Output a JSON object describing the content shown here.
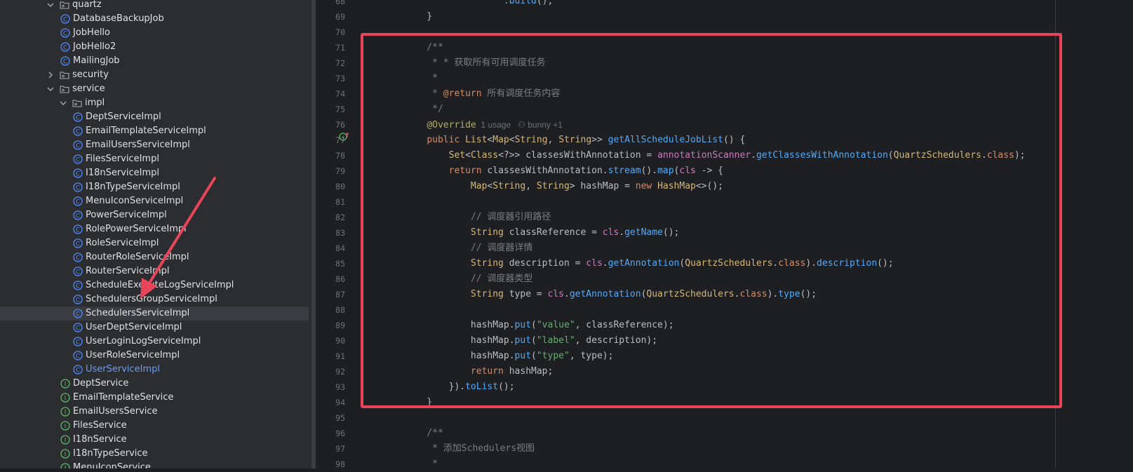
{
  "tree": {
    "items": [
      {
        "label": "quartz",
        "kind": "folder",
        "level": 0,
        "arrow": "down"
      },
      {
        "label": "DatabaseBackupJob",
        "kind": "class",
        "level": 1
      },
      {
        "label": "JobHello",
        "kind": "class",
        "level": 1
      },
      {
        "label": "JobHello2",
        "kind": "class",
        "level": 1
      },
      {
        "label": "MailingJob",
        "kind": "class",
        "level": 1
      },
      {
        "label": "security",
        "kind": "folder",
        "level": 0,
        "arrow": "right"
      },
      {
        "label": "service",
        "kind": "folder",
        "level": 0,
        "arrow": "down"
      },
      {
        "label": "impl",
        "kind": "folder",
        "level": 1,
        "arrow": "down"
      },
      {
        "label": "DeptServiceImpl",
        "kind": "class",
        "level": 2
      },
      {
        "label": "EmailTemplateServiceImpl",
        "kind": "class",
        "level": 2
      },
      {
        "label": "EmailUsersServiceImpl",
        "kind": "class",
        "level": 2
      },
      {
        "label": "FilesServiceImpl",
        "kind": "class",
        "level": 2
      },
      {
        "label": "I18nServiceImpl",
        "kind": "class",
        "level": 2
      },
      {
        "label": "I18nTypeServiceImpl",
        "kind": "class",
        "level": 2
      },
      {
        "label": "MenuIconServiceImpl",
        "kind": "class",
        "level": 2
      },
      {
        "label": "PowerServiceImpl",
        "kind": "class",
        "level": 2
      },
      {
        "label": "RolePowerServiceImpl",
        "kind": "class",
        "level": 2
      },
      {
        "label": "RoleServiceImpl",
        "kind": "class",
        "level": 2
      },
      {
        "label": "RouterRoleServiceImpl",
        "kind": "class",
        "level": 2
      },
      {
        "label": "RouterServiceImpl",
        "kind": "class",
        "level": 2
      },
      {
        "label": "ScheduleExecuteLogServiceImpl",
        "kind": "class",
        "level": 2
      },
      {
        "label": "SchedulersGroupServiceImpl",
        "kind": "class",
        "level": 2
      },
      {
        "label": "SchedulersServiceImpl",
        "kind": "class",
        "level": 2,
        "selected": true
      },
      {
        "label": "UserDeptServiceImpl",
        "kind": "class",
        "level": 2
      },
      {
        "label": "UserLoginLogServiceImpl",
        "kind": "class",
        "level": 2
      },
      {
        "label": "UserRoleServiceImpl",
        "kind": "class",
        "level": 2
      },
      {
        "label": "UserServiceImpl",
        "kind": "class",
        "level": 2,
        "blue": true
      },
      {
        "label": "DeptService",
        "kind": "interface",
        "level": 1
      },
      {
        "label": "EmailTemplateService",
        "kind": "interface",
        "level": 1
      },
      {
        "label": "EmailUsersService",
        "kind": "interface",
        "level": 1
      },
      {
        "label": "FilesService",
        "kind": "interface",
        "level": 1
      },
      {
        "label": "I18nService",
        "kind": "interface",
        "level": 1
      },
      {
        "label": "I18nTypeService",
        "kind": "interface",
        "level": 1
      },
      {
        "label": "MenuIconService",
        "kind": "interface",
        "level": 1
      }
    ]
  },
  "editor": {
    "first_line": 68,
    "lines": [
      [
        [
          "                  ",
          "dc"
        ],
        [
          ".build",
          "fn"
        ],
        [
          "();",
          "dc"
        ]
      ],
      [
        [
          "    }",
          "dc"
        ]
      ],
      [
        [
          "",
          "dc"
        ]
      ],
      [
        [
          "    /**",
          "cm"
        ]
      ],
      [
        [
          "     * * 获取所有可用调度任务",
          "cm"
        ]
      ],
      [
        [
          "     *",
          "cm"
        ]
      ],
      [
        [
          "     * ",
          "cm"
        ],
        [
          "@return",
          "dtag"
        ],
        [
          " 所有调度任务内容",
          "cm"
        ]
      ],
      [
        [
          "     */",
          "cm"
        ]
      ],
      [
        [
          "    ",
          "dc"
        ],
        [
          "@Override",
          "an"
        ],
        [
          "  1 usage   ⚇ bunny +1",
          "hint"
        ]
      ],
      [
        [
          "    ",
          "dc"
        ],
        [
          "public ",
          "kw"
        ],
        [
          "List",
          "ty"
        ],
        [
          "<",
          "dc"
        ],
        [
          "Map",
          "ty"
        ],
        [
          "<",
          "dc"
        ],
        [
          "String",
          "ty"
        ],
        [
          ", ",
          "dc"
        ],
        [
          "String",
          "ty"
        ],
        [
          ">> ",
          "dc"
        ],
        [
          "getAllScheduleJobList",
          "fn"
        ],
        [
          "() {",
          "dc"
        ]
      ],
      [
        [
          "        ",
          "dc"
        ],
        [
          "Set",
          "ty"
        ],
        [
          "<",
          "dc"
        ],
        [
          "Class",
          "ty"
        ],
        [
          "<?>> classesWithAnnotation = ",
          "dc"
        ],
        [
          "annotationScanner",
          "fld"
        ],
        [
          ".",
          "dc"
        ],
        [
          "getClassesWithAnnotation",
          "fn"
        ],
        [
          "(",
          "dc"
        ],
        [
          "QuartzSchedulers",
          "ty"
        ],
        [
          ".",
          "dc"
        ],
        [
          "class",
          "kw"
        ],
        [
          ");",
          "dc"
        ]
      ],
      [
        [
          "        ",
          "dc"
        ],
        [
          "return ",
          "kw"
        ],
        [
          "classesWithAnnotation.",
          "dc"
        ],
        [
          "stream",
          "fn"
        ],
        [
          "().",
          "dc"
        ],
        [
          "map",
          "fn"
        ],
        [
          "(",
          "dc"
        ],
        [
          "cls",
          "pm"
        ],
        [
          " -> {",
          "dc"
        ]
      ],
      [
        [
          "            ",
          "dc"
        ],
        [
          "Map",
          "ty"
        ],
        [
          "<",
          "dc"
        ],
        [
          "String",
          "ty"
        ],
        [
          ", ",
          "dc"
        ],
        [
          "String",
          "ty"
        ],
        [
          "> hashMap = ",
          "dc"
        ],
        [
          "new ",
          "kw"
        ],
        [
          "HashMap",
          "ty"
        ],
        [
          "<>();",
          "dc"
        ]
      ],
      [
        [
          "",
          "dc"
        ]
      ],
      [
        [
          "            // 调度器引用路径",
          "cm"
        ]
      ],
      [
        [
          "            ",
          "dc"
        ],
        [
          "String ",
          "ty"
        ],
        [
          "classReference = ",
          "dc"
        ],
        [
          "cls",
          "pm"
        ],
        [
          ".",
          "dc"
        ],
        [
          "getName",
          "fn"
        ],
        [
          "();",
          "dc"
        ]
      ],
      [
        [
          "            // 调度器详情",
          "cm"
        ]
      ],
      [
        [
          "            ",
          "dc"
        ],
        [
          "String ",
          "ty"
        ],
        [
          "description = ",
          "dc"
        ],
        [
          "cls",
          "pm"
        ],
        [
          ".",
          "dc"
        ],
        [
          "getAnnotation",
          "fn"
        ],
        [
          "(",
          "dc"
        ],
        [
          "QuartzSchedulers",
          "ty"
        ],
        [
          ".",
          "dc"
        ],
        [
          "class",
          "kw"
        ],
        [
          ").",
          "dc"
        ],
        [
          "description",
          "fn"
        ],
        [
          "();",
          "dc"
        ]
      ],
      [
        [
          "            // 调度器类型",
          "cm"
        ]
      ],
      [
        [
          "            ",
          "dc"
        ],
        [
          "String ",
          "ty"
        ],
        [
          "type = ",
          "dc"
        ],
        [
          "cls",
          "pm"
        ],
        [
          ".",
          "dc"
        ],
        [
          "getAnnotation",
          "fn"
        ],
        [
          "(",
          "dc"
        ],
        [
          "QuartzSchedulers",
          "ty"
        ],
        [
          ".",
          "dc"
        ],
        [
          "class",
          "kw"
        ],
        [
          ").",
          "dc"
        ],
        [
          "type",
          "fn"
        ],
        [
          "();",
          "dc"
        ]
      ],
      [
        [
          "",
          "dc"
        ]
      ],
      [
        [
          "            hashMap.",
          "dc"
        ],
        [
          "put",
          "fn"
        ],
        [
          "(",
          "dc"
        ],
        [
          "\"value\"",
          "st"
        ],
        [
          ", classReference);",
          "dc"
        ]
      ],
      [
        [
          "            hashMap.",
          "dc"
        ],
        [
          "put",
          "fn"
        ],
        [
          "(",
          "dc"
        ],
        [
          "\"label\"",
          "st"
        ],
        [
          ", description);",
          "dc"
        ]
      ],
      [
        [
          "            hashMap.",
          "dc"
        ],
        [
          "put",
          "fn"
        ],
        [
          "(",
          "dc"
        ],
        [
          "\"type\"",
          "st"
        ],
        [
          ", type);",
          "dc"
        ]
      ],
      [
        [
          "            ",
          "dc"
        ],
        [
          "return ",
          "kw"
        ],
        [
          "hashMap;",
          "dc"
        ]
      ],
      [
        [
          "        }).",
          "dc"
        ],
        [
          "toList",
          "fn"
        ],
        [
          "();",
          "dc"
        ]
      ],
      [
        [
          "    }",
          "dc"
        ]
      ],
      [
        [
          "",
          "dc"
        ]
      ],
      [
        [
          "    /**",
          "cm"
        ]
      ],
      [
        [
          "     * 添加Schedulers视图",
          "cm"
        ]
      ],
      [
        [
          "     *",
          "cm"
        ]
      ]
    ]
  },
  "colors": {
    "highlight": "#e8445a",
    "class_icon": "#548af7",
    "interface_icon": "#5fb865"
  }
}
